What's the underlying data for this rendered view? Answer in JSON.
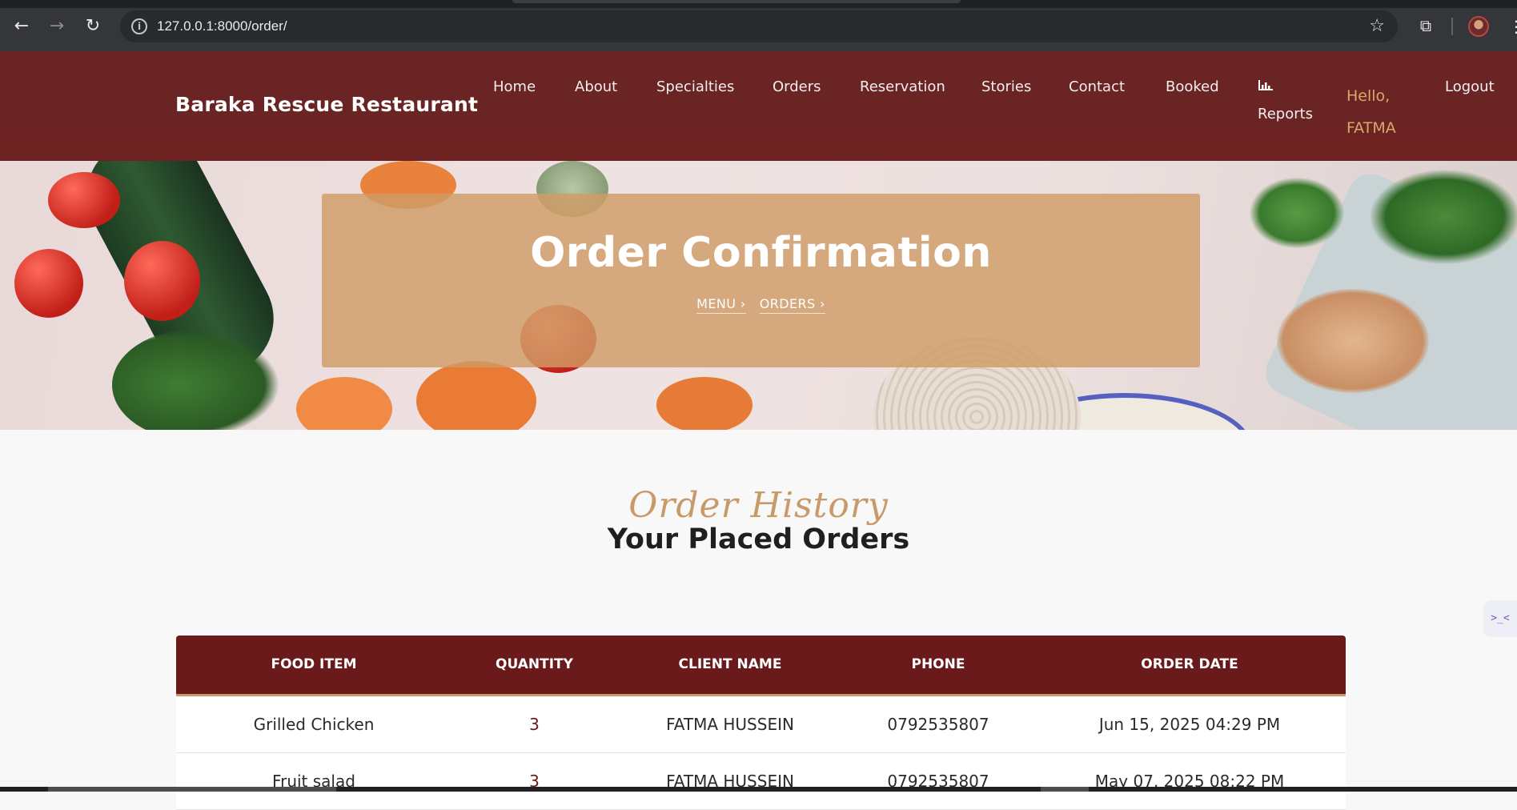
{
  "browser": {
    "url": "127.0.0.1:8000/order/",
    "back_icon": "back-arrow-icon",
    "forward_icon": "forward-arrow-icon",
    "reload_icon": "reload-icon",
    "info_icon": "site-info-icon",
    "star_icon": "bookmark-star-icon",
    "extensions_icon": "extensions-puzzle-icon",
    "menu_icon": "more-vert-icon"
  },
  "header": {
    "brand": "Baraka Rescue Restaurant",
    "nav": {
      "home": "Home",
      "about": "About",
      "specialties": "Specialties",
      "orders": "Orders",
      "reservation": "Reservation",
      "stories": "Stories",
      "contact": "Contact",
      "booked": "Booked",
      "reports": "Reports",
      "logout": "Logout"
    },
    "greeting": "Hello, FATMA"
  },
  "hero": {
    "title": "Order Confirmation",
    "breadcrumbs": [
      "MENU",
      "ORDERS"
    ]
  },
  "section": {
    "script_title": "Order History",
    "title": "Your Placed Orders"
  },
  "table": {
    "headers": [
      "FOOD ITEM",
      "QUANTITY",
      "CLIENT NAME",
      "PHONE",
      "ORDER DATE"
    ],
    "rows": [
      [
        "Grilled Chicken",
        "3",
        "FATMA HUSSEIN",
        "0792535807",
        "Jun 15, 2025 04:29 PM"
      ],
      [
        "Fruit salad",
        "3",
        "FATMA HUSSEIN",
        "0792535807",
        "May 07, 2025 08:22 PM"
      ]
    ]
  },
  "side_widget": {
    "label": ">_<"
  },
  "colors": {
    "header_bg": "#6a2424",
    "accent_gold": "#c89a68",
    "table_header_bg": "#6a1a1a",
    "hero_overlay": "#d09c66"
  }
}
